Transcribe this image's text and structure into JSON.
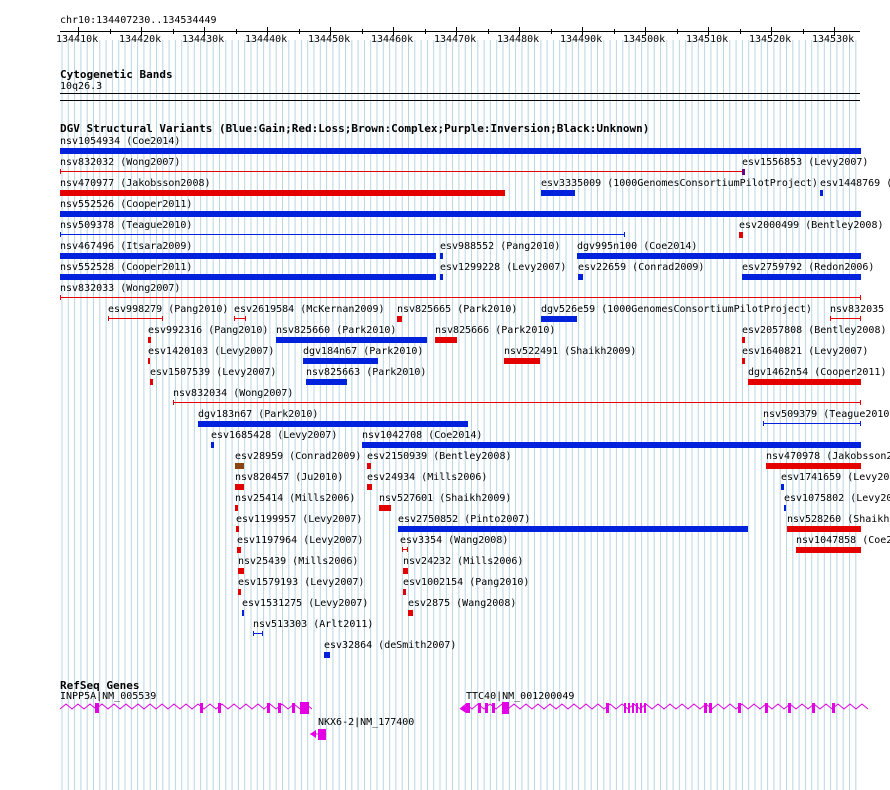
{
  "colors": {
    "gain": "#0022dd",
    "loss": "#e50000",
    "complex": "#8b4513",
    "gene": "#e400e4",
    "grid": "#b8d6e4",
    "axis": "#000000"
  },
  "ruler": {
    "location": "chr10:134407230..134534449",
    "ticks": [
      "134410k",
      "134420k",
      "134430k",
      "134440k",
      "134450k",
      "134460k",
      "134470k",
      "134480k",
      "134490k",
      "134500k",
      "134510k",
      "134520k",
      "134530k"
    ]
  },
  "cytoband": {
    "title": "Cytogenetic Bands",
    "band": "10q26.3"
  },
  "dgv": {
    "title": "DGV Structural Variants (Blue:Gain;Red:Loss;Brown:Complex;Purple:Inversion;Black:Unknown)",
    "variants": [
      {
        "label": "nsv1054934 (Coe2014)",
        "type": "gain",
        "style": "thick"
      },
      {
        "label": "nsv832032 (Wong2007)",
        "type": "loss",
        "style": "line"
      },
      {
        "label": "esv1556853 (Levy2007)",
        "type": "inversion",
        "style": "small"
      },
      {
        "label": "nsv470977 (Jakobsson2008)",
        "type": "loss",
        "style": "thick"
      },
      {
        "label": "esv3335009 (1000GenomesConsortiumPilotProject)",
        "type": "gain",
        "style": "thick"
      },
      {
        "label": "esv1448769 (",
        "type": "gain",
        "style": "small"
      },
      {
        "label": "nsv552526 (Cooper2011)",
        "type": "gain",
        "style": "thick"
      },
      {
        "label": "nsv509378 (Teague2010)",
        "type": "gain",
        "style": "line"
      },
      {
        "label": "esv2000499 (Bentley2008)",
        "type": "loss",
        "style": "small"
      },
      {
        "label": "nsv467496 (Itsara2009)",
        "type": "gain",
        "style": "thick"
      },
      {
        "label": "esv988552 (Pang2010)",
        "type": "gain",
        "style": "small"
      },
      {
        "label": "dgv995n100 (Coe2014)",
        "type": "gain",
        "style": "thick"
      },
      {
        "label": "nsv552528 (Cooper2011)",
        "type": "gain",
        "style": "thick"
      },
      {
        "label": "esv1299228 (Levy2007)",
        "type": "gain",
        "style": "small"
      },
      {
        "label": "esv22659 (Conrad2009)",
        "type": "gain",
        "style": "small"
      },
      {
        "label": "esv2759792 (Redon2006)",
        "type": "gain",
        "style": "thick"
      },
      {
        "label": "nsv832033 (Wong2007)",
        "type": "loss",
        "style": "line"
      },
      {
        "label": "esv998279 (Pang2010)",
        "type": "loss",
        "style": "line"
      },
      {
        "label": "esv2619584 (McKernan2009)",
        "type": "loss",
        "style": "line"
      },
      {
        "label": "nsv825665 (Park2010)",
        "type": "loss",
        "style": "small"
      },
      {
        "label": "dgv526e59 (1000GenomesConsortiumPilotProject)",
        "type": "gain",
        "style": "thick"
      },
      {
        "label": "nsv832035 (",
        "type": "loss",
        "style": "line"
      },
      {
        "label": "esv992316 (Pang2010)",
        "type": "loss",
        "style": "small"
      },
      {
        "label": "nsv825660 (Park2010)",
        "type": "gain",
        "style": "thick"
      },
      {
        "label": "nsv825666 (Park2010)",
        "type": "loss",
        "style": "thick"
      },
      {
        "label": "esv2057808 (Bentley2008)",
        "type": "loss",
        "style": "small"
      },
      {
        "label": "esv1420103 (Levy2007)",
        "type": "loss",
        "style": "small"
      },
      {
        "label": "dgv184n67 (Park2010)",
        "type": "gain",
        "style": "thick"
      },
      {
        "label": "nsv522491 (Shaikh2009)",
        "type": "loss",
        "style": "thick"
      },
      {
        "label": "esv1640821 (Levy2007)",
        "type": "loss",
        "style": "small"
      },
      {
        "label": "esv1507539 (Levy2007)",
        "type": "loss",
        "style": "small"
      },
      {
        "label": "nsv825663 (Park2010)",
        "type": "gain",
        "style": "thick"
      },
      {
        "label": "dgv1462n54 (Cooper2011)",
        "type": "loss",
        "style": "thick"
      },
      {
        "label": "nsv832034 (Wong2007)",
        "type": "loss",
        "style": "line"
      },
      {
        "label": "dgv183n67 (Park2010)",
        "type": "gain",
        "style": "thick"
      },
      {
        "label": "nsv509379 (Teague2010",
        "type": "gain",
        "style": "line"
      },
      {
        "label": "esv1685428 (Levy2007)",
        "type": "gain",
        "style": "small"
      },
      {
        "label": "nsv1042708 (Coe2014)",
        "type": "gain",
        "style": "thick"
      },
      {
        "label": "esv28959 (Conrad2009)",
        "type": "complex",
        "style": "small"
      },
      {
        "label": "esv2150939 (Bentley2008)",
        "type": "loss",
        "style": "small"
      },
      {
        "label": "nsv470978 (Jakobsson2",
        "type": "loss",
        "style": "thick"
      },
      {
        "label": "nsv820457 (Ju2010)",
        "type": "loss",
        "style": "small"
      },
      {
        "label": "esv24934 (Mills2006)",
        "type": "loss",
        "style": "small"
      },
      {
        "label": "esv1741659 (Levy20",
        "type": "gain",
        "style": "small"
      },
      {
        "label": "nsv25414 (Mills2006)",
        "type": "loss",
        "style": "small"
      },
      {
        "label": "nsv527601 (Shaikh2009)",
        "type": "loss",
        "style": "small"
      },
      {
        "label": "esv1075802 (Levy20",
        "type": "gain",
        "style": "small"
      },
      {
        "label": "esv1199957 (Levy2007)",
        "type": "loss",
        "style": "small"
      },
      {
        "label": "esv2750852 (Pinto2007)",
        "type": "gain",
        "style": "thick"
      },
      {
        "label": "nsv528260 (Shaikh",
        "type": "loss",
        "style": "thick"
      },
      {
        "label": "esv1197964 (Levy2007)",
        "type": "loss",
        "style": "small"
      },
      {
        "label": "esv3354 (Wang2008)",
        "type": "loss",
        "style": "line"
      },
      {
        "label": "nsv1047858 (Coe2",
        "type": "loss",
        "style": "thick"
      },
      {
        "label": "nsv25439 (Mills2006)",
        "type": "loss",
        "style": "small"
      },
      {
        "label": "nsv24232 (Mills2006)",
        "type": "loss",
        "style": "small"
      },
      {
        "label": "esv1579193 (Levy2007)",
        "type": "loss",
        "style": "small"
      },
      {
        "label": "esv1002154 (Pang2010)",
        "type": "loss",
        "style": "small"
      },
      {
        "label": "esv1531275 (Levy2007)",
        "type": "gain",
        "style": "small"
      },
      {
        "label": "esv2875 (Wang2008)",
        "type": "loss",
        "style": "small"
      },
      {
        "label": "nsv513303 (Arlt2011)",
        "type": "gain",
        "style": "line"
      },
      {
        "label": "esv32864 (deSmith2007)",
        "type": "gain",
        "style": "small"
      }
    ]
  },
  "refseq": {
    "title": "RefSeq Genes",
    "genes": [
      {
        "label": "INPP5A|NM_005539"
      },
      {
        "label": "TTC40|NM_001200049"
      },
      {
        "label": "NKX6-2|NM_177400"
      }
    ]
  }
}
